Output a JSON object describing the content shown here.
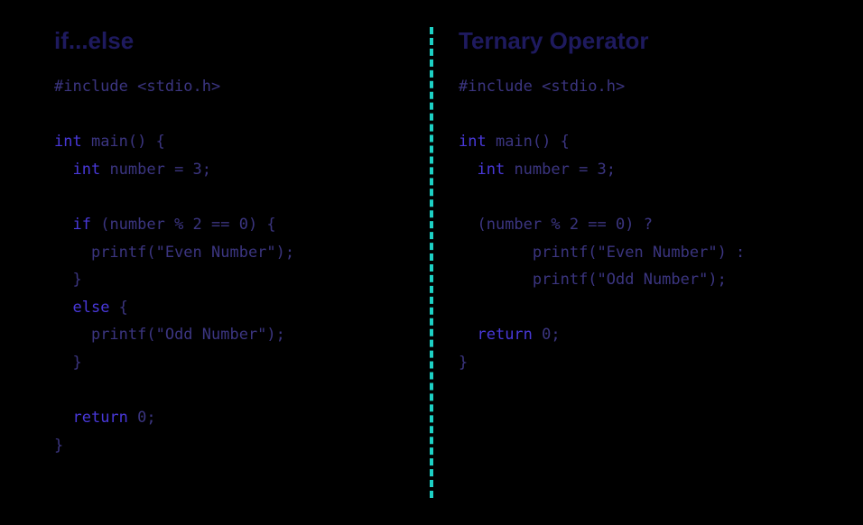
{
  "left": {
    "heading": "if...else",
    "lines": [
      {
        "indent": 0,
        "tokens": [
          {
            "t": "#include <stdio.h>",
            "kw": false
          }
        ]
      },
      {
        "indent": 0,
        "tokens": []
      },
      {
        "indent": 0,
        "tokens": [
          {
            "t": "int",
            "kw": true
          },
          {
            "t": " main() {",
            "kw": false
          }
        ]
      },
      {
        "indent": 1,
        "tokens": [
          {
            "t": "int",
            "kw": true
          },
          {
            "t": " number = 3;",
            "kw": false
          }
        ]
      },
      {
        "indent": 0,
        "tokens": []
      },
      {
        "indent": 1,
        "tokens": [
          {
            "t": "if",
            "kw": true
          },
          {
            "t": " (number % 2 == 0) {",
            "kw": false
          }
        ]
      },
      {
        "indent": 2,
        "tokens": [
          {
            "t": "printf(\"Even Number\");",
            "kw": false
          }
        ]
      },
      {
        "indent": 1,
        "tokens": [
          {
            "t": "}",
            "kw": false
          }
        ]
      },
      {
        "indent": 1,
        "tokens": [
          {
            "t": "else",
            "kw": true
          },
          {
            "t": " {",
            "kw": false
          }
        ]
      },
      {
        "indent": 2,
        "tokens": [
          {
            "t": "printf(\"Odd Number\");",
            "kw": false
          }
        ]
      },
      {
        "indent": 1,
        "tokens": [
          {
            "t": "}",
            "kw": false
          }
        ]
      },
      {
        "indent": 0,
        "tokens": []
      },
      {
        "indent": 1,
        "tokens": [
          {
            "t": "return",
            "kw": true
          },
          {
            "t": " 0;",
            "kw": false
          }
        ]
      },
      {
        "indent": 0,
        "tokens": [
          {
            "t": "}",
            "kw": false
          }
        ]
      }
    ]
  },
  "right": {
    "heading": "Ternary Operator",
    "lines": [
      {
        "indent": 0,
        "tokens": [
          {
            "t": "#include <stdio.h>",
            "kw": false
          }
        ]
      },
      {
        "indent": 0,
        "tokens": []
      },
      {
        "indent": 0,
        "tokens": [
          {
            "t": "int",
            "kw": true
          },
          {
            "t": " main() {",
            "kw": false
          }
        ]
      },
      {
        "indent": 1,
        "tokens": [
          {
            "t": "int",
            "kw": true
          },
          {
            "t": " number = 3;",
            "kw": false
          }
        ]
      },
      {
        "indent": 0,
        "tokens": []
      },
      {
        "indent": 1,
        "tokens": [
          {
            "t": "(number % 2 == 0) ?",
            "kw": false
          }
        ]
      },
      {
        "indent": 4,
        "tokens": [
          {
            "t": "printf(\"Even Number\") :",
            "kw": false
          }
        ]
      },
      {
        "indent": 4,
        "tokens": [
          {
            "t": "printf(\"Odd Number\");",
            "kw": false
          }
        ]
      },
      {
        "indent": 0,
        "tokens": []
      },
      {
        "indent": 1,
        "tokens": [
          {
            "t": "return",
            "kw": true
          },
          {
            "t": " 0;",
            "kw": false
          }
        ]
      },
      {
        "indent": 0,
        "tokens": [
          {
            "t": "}",
            "kw": false
          }
        ]
      }
    ]
  }
}
